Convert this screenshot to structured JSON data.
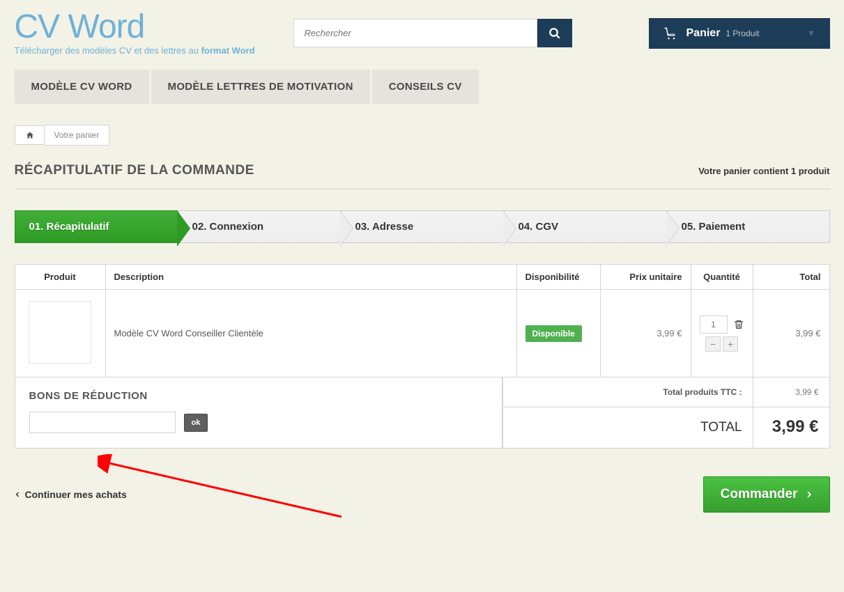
{
  "header": {
    "logo": "CV Word",
    "tagline_prefix": "Télécharger des modèles CV et des lettres au ",
    "tagline_bold": "format Word",
    "search_placeholder": "Rechercher",
    "cart_label": "Panier",
    "cart_count": "1 Produit"
  },
  "nav": {
    "items": [
      "MODÈLE CV WORD",
      "MODÈLE LETTRES DE MOTIVATION",
      "CONSEILS CV"
    ]
  },
  "breadcrumb": {
    "current": "Votre panier"
  },
  "page": {
    "title": "RÉCAPITULATIF DE LA COMMANDE",
    "cart_summary": "Votre panier contient 1 produit"
  },
  "steps": [
    "01. Récapitulatif",
    "02. Connexion",
    "03. Adresse",
    "04. CGV",
    "05. Paiement"
  ],
  "table": {
    "headers": {
      "product": "Produit",
      "description": "Description",
      "availability": "Disponibilité",
      "unit_price": "Prix unitaire",
      "quantity": "Quantité",
      "total": "Total"
    },
    "rows": [
      {
        "description": "Modèle CV Word Conseiller Clientèle",
        "availability": "Disponible",
        "unit_price": "3,99 €",
        "quantity": "1",
        "total": "3,99 €"
      }
    ]
  },
  "voucher": {
    "title": "BONS DE RÉDUCTION",
    "ok": "ok"
  },
  "totals": {
    "products_label": "Total produits TTC :",
    "products_value": "3,99 €",
    "grand_label": "TOTAL",
    "grand_value": "3,99 €"
  },
  "footer": {
    "continue": "Continuer mes achats",
    "order": "Commander"
  }
}
